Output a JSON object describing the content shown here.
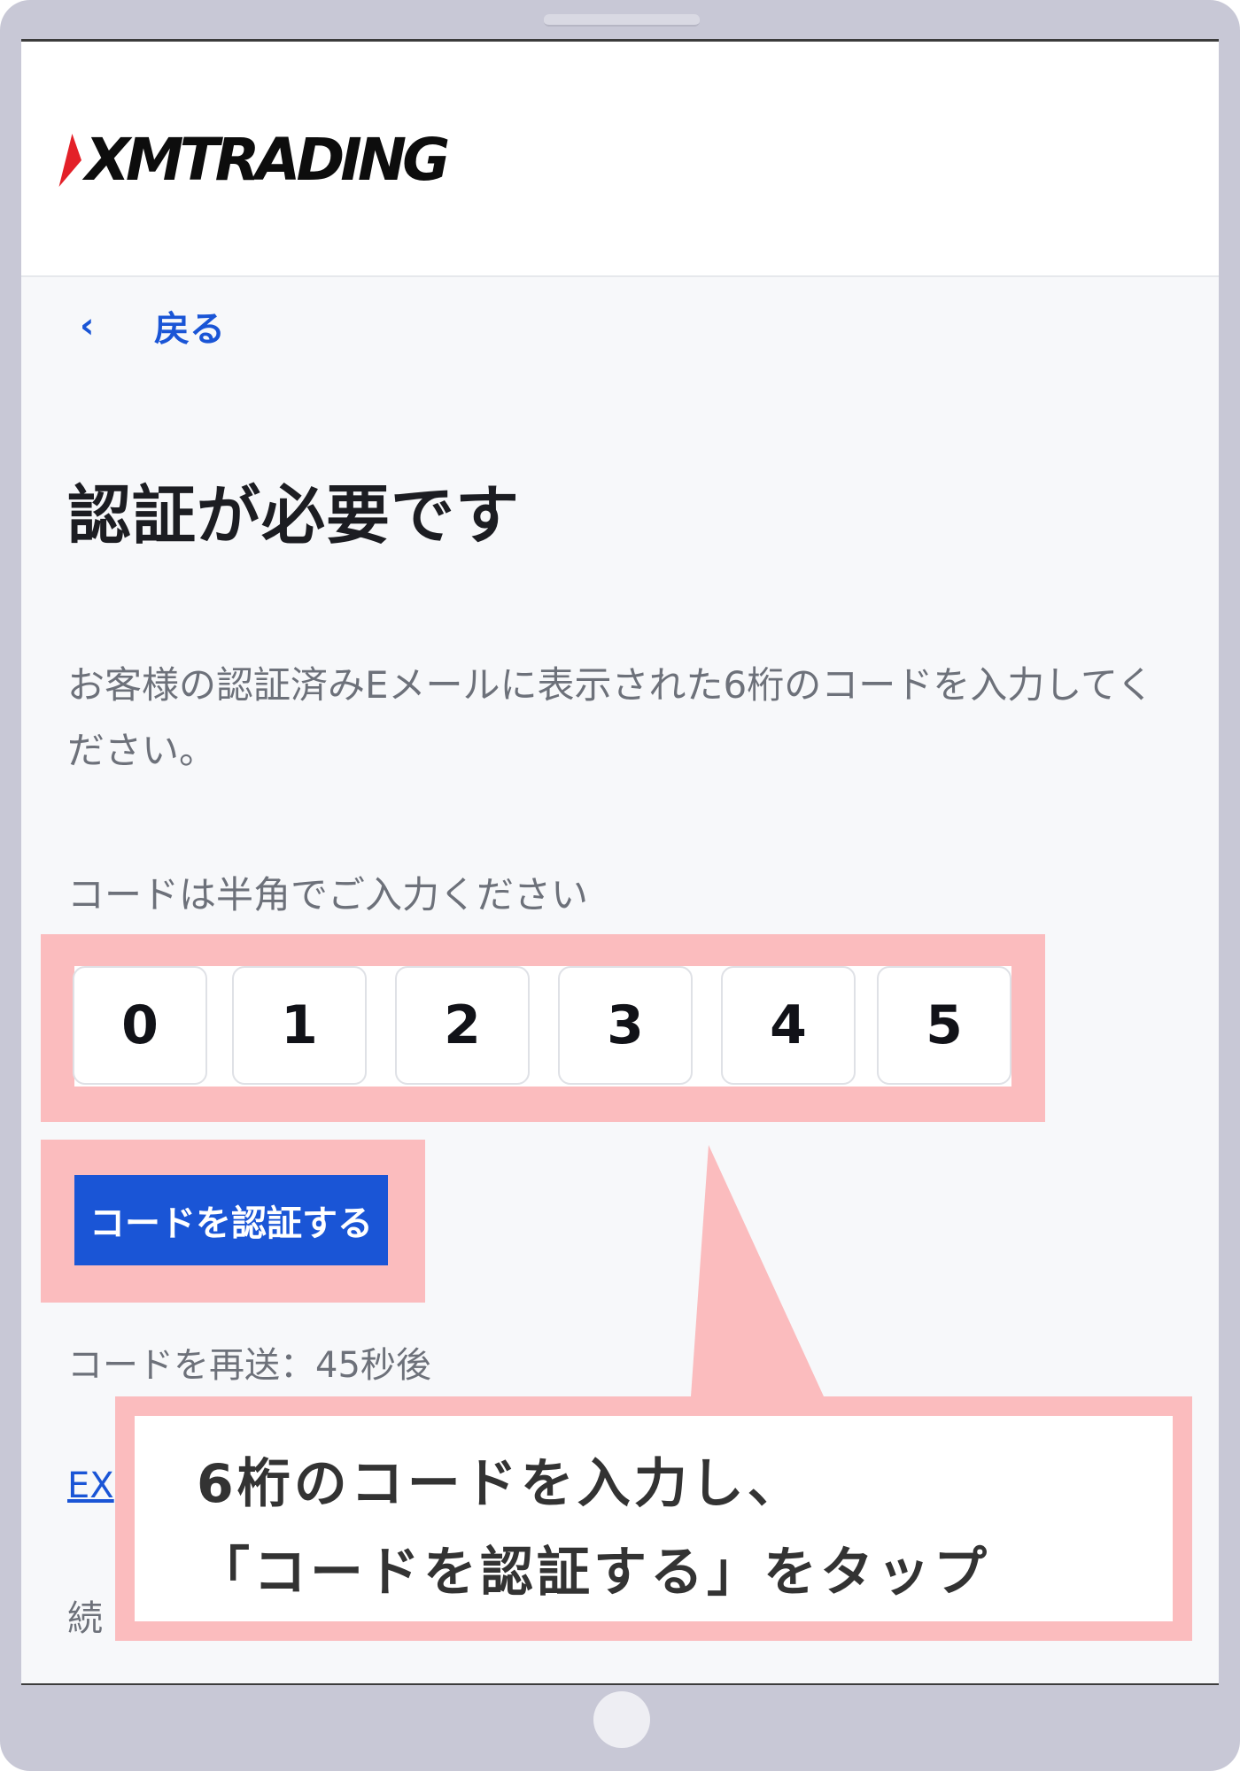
{
  "header": {
    "logo_text": "XMTRADING"
  },
  "nav": {
    "back_icon": "‹",
    "back_label": "戻る"
  },
  "page": {
    "title": "認証が必要です",
    "description": "お客様の認証済みEメールに表示された6桁のコードを入力してください。",
    "hint": "コードは半角でご入力ください"
  },
  "code_inputs": {
    "digits": [
      "0",
      "1",
      "2",
      "3",
      "4",
      "5"
    ]
  },
  "actions": {
    "verify_label": "コードを認証する",
    "resend_text": "コードを再送：45秒後",
    "email_link_partial": "EX",
    "continue_partial": "続"
  },
  "callout": {
    "line1": "6桁のコードを入力し、",
    "line2": "「コードを認証する」をタップ"
  },
  "colors": {
    "accent": "#1a55d6",
    "highlight": "#fbbcbe",
    "device_frame": "#c8c8d6",
    "logo_red": "#e32028"
  },
  "icons": [
    "chevron-left-icon",
    "logo-mark-icon",
    "home-button-icon"
  ]
}
